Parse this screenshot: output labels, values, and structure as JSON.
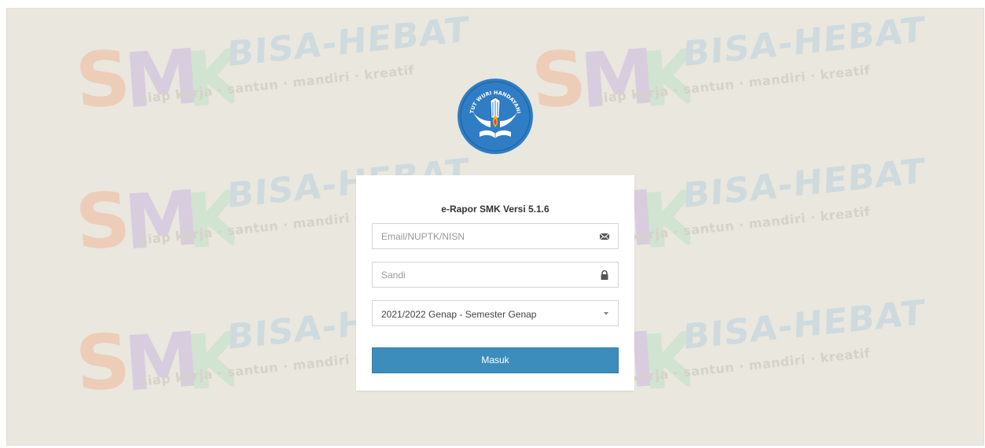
{
  "watermark": {
    "brand": "SMK",
    "slogan": "BISA-HEBAT",
    "tagline": "siap kerja · santun · mandiri · kreatif"
  },
  "logo": {
    "motto": "TUT WURI HANDAYANI"
  },
  "login": {
    "title": "e-Rapor SMK Versi 5.1.6",
    "email_placeholder": "Email/NUPTK/NISN",
    "password_placeholder": "Sandi",
    "semester_selected": "2021/2022 Genap - Semester Genap",
    "submit_label": "Masuk"
  },
  "icons": {
    "email": "envelope-icon",
    "password": "lock-icon",
    "dropdown": "caret-down-icon"
  },
  "colors": {
    "background": "#e9e7de",
    "button": "#3c8dbc",
    "logo_blue": "#2f7dc4"
  }
}
